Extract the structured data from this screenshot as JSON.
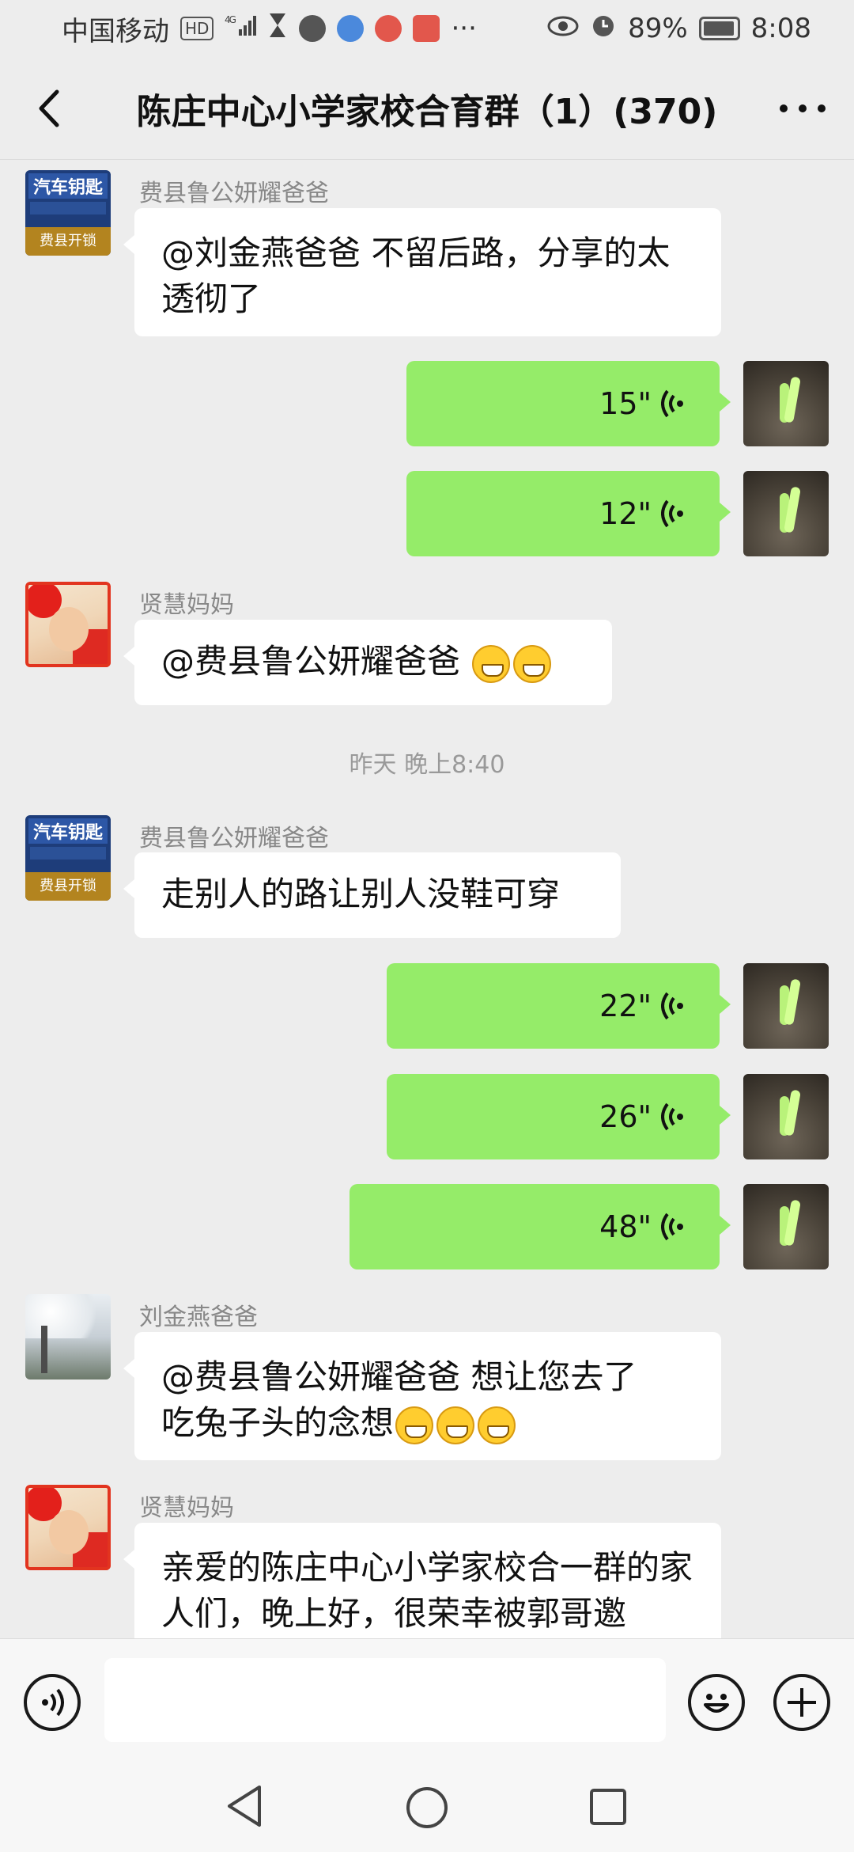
{
  "status": {
    "carrier": "中国移动",
    "hd": "HD",
    "network": "4G",
    "battery": "89%",
    "time": "8:08"
  },
  "header": {
    "title": "陈庄中心小学家校合育群（1）(370)"
  },
  "messages": {
    "m1": {
      "sender": "费县鲁公妍耀爸爸",
      "text": "@刘金燕爸爸 不留后路，分享的太透彻了"
    },
    "v1": {
      "duration": "15\""
    },
    "v2": {
      "duration": "12\""
    },
    "m2": {
      "sender": "贤慧妈妈",
      "text": "@费县鲁公妍耀爸爸 "
    },
    "time1": "昨天 晚上8:40",
    "m3": {
      "sender": "费县鲁公妍耀爸爸",
      "text": "走别人的路让别人没鞋可穿"
    },
    "v3": {
      "duration": "22\""
    },
    "v4": {
      "duration": "26\""
    },
    "v5": {
      "duration": "48\""
    },
    "m4": {
      "sender": "刘金燕爸爸",
      "text_line1": "@费县鲁公妍耀爸爸 想让您去了",
      "text_line2": "吃兔子头的念想"
    },
    "m5": {
      "sender": "贤慧妈妈",
      "text": "亲爱的陈庄中心小学家校合一群的家人们，晚上好，很荣幸被郭哥邀"
    }
  },
  "avatars": {
    "car_line1": "汽车钥匙",
    "car_line2": "费县开锁"
  },
  "colors": {
    "background": "#ededed",
    "self_bubble": "#95ec69",
    "other_bubble": "#ffffff"
  }
}
